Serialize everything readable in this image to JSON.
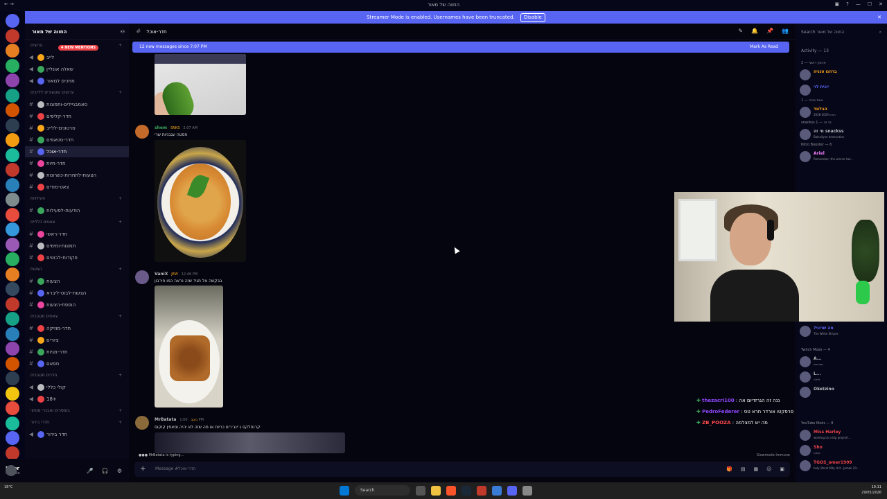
{
  "window": {
    "title": "החווה של מאור"
  },
  "streamer_bar": {
    "text": "Streamer Mode is enabled. Usernames have been truncated.",
    "disable_label": "Disable",
    "close_label": "✕"
  },
  "guild": {
    "name": "החווה של מאור",
    "mentions_pill": "4 NEW MENTIONS"
  },
  "channels": [
    {
      "kind": "cat",
      "label": "ערוצים"
    },
    {
      "kind": "voice",
      "label": "לייב"
    },
    {
      "kind": "voice",
      "label": "שאלה אונליין"
    },
    {
      "kind": "voice",
      "label": "מחכים למאור"
    },
    {
      "kind": "cat",
      "label": "ערוצים שקשורים ללייבים"
    },
    {
      "kind": "text",
      "label": "סאמבניילים-ותמונות"
    },
    {
      "kind": "text",
      "label": "חדר-קליפים"
    },
    {
      "kind": "text",
      "label": "סרטונים-ללייב"
    },
    {
      "kind": "text",
      "label": "חדר-סטאפים"
    },
    {
      "kind": "text",
      "label": "חדר-אוכל",
      "active": true
    },
    {
      "kind": "text",
      "label": "חדר-חיות"
    },
    {
      "kind": "text",
      "label": "הצעות-לתחרות-כשרונות"
    },
    {
      "kind": "text",
      "label": "צאט-מודים"
    },
    {
      "kind": "cat",
      "label": "פעילויות"
    },
    {
      "kind": "text",
      "label": "הודעות-לפעילות"
    },
    {
      "kind": "cat",
      "label": "צאטים כלליים"
    },
    {
      "kind": "text",
      "label": "חדר-ראשי"
    },
    {
      "kind": "text",
      "label": "תמונות-ומימים"
    },
    {
      "kind": "text",
      "label": "פקודות-לבוטים"
    },
    {
      "kind": "cat",
      "label": "הצעות"
    },
    {
      "kind": "text",
      "label": "הצעות"
    },
    {
      "kind": "text",
      "label": "הצעות-לבוט-ליברא"
    },
    {
      "kind": "text",
      "label": "הוספת-הצעות"
    },
    {
      "kind": "cat",
      "label": "צאטים מגובבים"
    },
    {
      "kind": "text",
      "label": "חדר-מוזיקה"
    },
    {
      "kind": "text",
      "label": "ציורים"
    },
    {
      "kind": "text",
      "label": "חדר-מגיות"
    },
    {
      "kind": "text",
      "label": "ספאם"
    },
    {
      "kind": "cat",
      "label": "חדרים מגובבים"
    },
    {
      "kind": "voice",
      "label": "קולי כללי"
    },
    {
      "kind": "voice",
      "label": "18+"
    },
    {
      "kind": "cat",
      "label": "בוססרים ואבכרי מוניצי"
    },
    {
      "kind": "cat",
      "label": "חדרי בירור"
    },
    {
      "kind": "voice",
      "label": "חדר בירור"
    }
  ],
  "user": {
    "name": "Maor",
    "status": "Invisible"
  },
  "channel_header": {
    "name": "חדר-אוכל"
  },
  "new_messages": {
    "text": "12 new messages since 7:07 PM",
    "mark_read": "Mark As Read"
  },
  "messages": [
    {
      "author": "shem",
      "badge": "SNKS",
      "time": "2:07 AM",
      "text": "פסטה עגבניות שרי",
      "color": "#3ba55c"
    },
    {
      "author": "VaniX",
      "badge": "JEW",
      "time": "12:46 PM",
      "text": "בבקשה אל תגיד שזה נראה כמו חירבון",
      "color": "#b9bbbe"
    },
    {
      "author": "MrBatata",
      "badge": "כוכב",
      "time": "1:00 PM",
      "text": "קרנפלקס ג׳ינג׳רים כריות או מה שזה לא יהיה ומאפין קוקוס",
      "color": "#b9bbbe"
    }
  ],
  "typing": "MrBatata is typing...",
  "slowmode": "Slowmode Immune",
  "composer": {
    "placeholder": "Message #חדר-אוכל"
  },
  "members": {
    "search": "Search החווה של מאור",
    "activity": "Activity — 13",
    "groups": [
      {
        "head": "אדמין ראשי — 2",
        "rows": [
          {
            "name": "ברהנו טגניה",
            "status": "",
            "color": "#faa61a"
          },
          {
            "name": "יונית לוי",
            "status": "",
            "color": "#5865f2"
          }
        ]
      },
      {
        "head": "צוות גבוה — 1",
        "rows": [
          {
            "name": "הבלונד",
            "status": "2028-2029 חודש",
            "color": "#faa61a"
          }
        ]
      },
      {
        "head": "snackss מי זה — 1",
        "rows": [
          {
            "name": "מי זה snackss",
            "status": "Balesilyne destruction",
            "color": "#b9bbbe"
          }
        ]
      },
      {
        "head": "Nitro Booster — 6",
        "rows": [
          {
            "name": "Ariel",
            "status": "Remember, the winner tak...",
            "color": "#f47fff"
          }
        ]
      }
    ],
    "after_cam": [
      {
        "name": "?מה שרוני",
        "status": "The White Stripes",
        "color": "#5865f2"
      }
    ],
    "twitch_head": "Twitch Mods — 4",
    "twitch_rows": [
      {
        "name": "A...",
        "status": "מפורסם",
        "color": "#b9bbbe"
      },
      {
        "name": "L...",
        "status": "לוליה",
        "color": "#b9bbbe"
      },
      {
        "name": "Oketzino",
        "status": "",
        "color": "#b9bbbe"
      }
    ],
    "youtube_head": "YouTube Mods — 8",
    "youtube_rows": [
      {
        "name": "Miss Harley",
        "status": "working on a big project!...",
        "color": "#ed4245"
      },
      {
        "name": "Sho",
        "status": "שיפוט",
        "color": "#ed4245"
      },
      {
        "name": "TGOS_omer1909",
        "status": "holy literal titty shit - Jamak 20...",
        "color": "#ed4245"
      }
    ]
  },
  "chat_overlay": [
    {
      "name": "thezacri100",
      "text": "ננה זה הגרזדיום אה",
      "color": "#9147ff"
    },
    {
      "name": "PedroFederer",
      "text": "פרפקטו אורדר חרא טס",
      "color": "#9147ff"
    },
    {
      "name": "ZB_POOZA",
      "text": "מה יש למצלמה",
      "color": "#ff4a4a"
    }
  ],
  "taskbar": {
    "search": "Search",
    "time": "19:11",
    "date": "29/05/2026",
    "weather": "18°C"
  }
}
